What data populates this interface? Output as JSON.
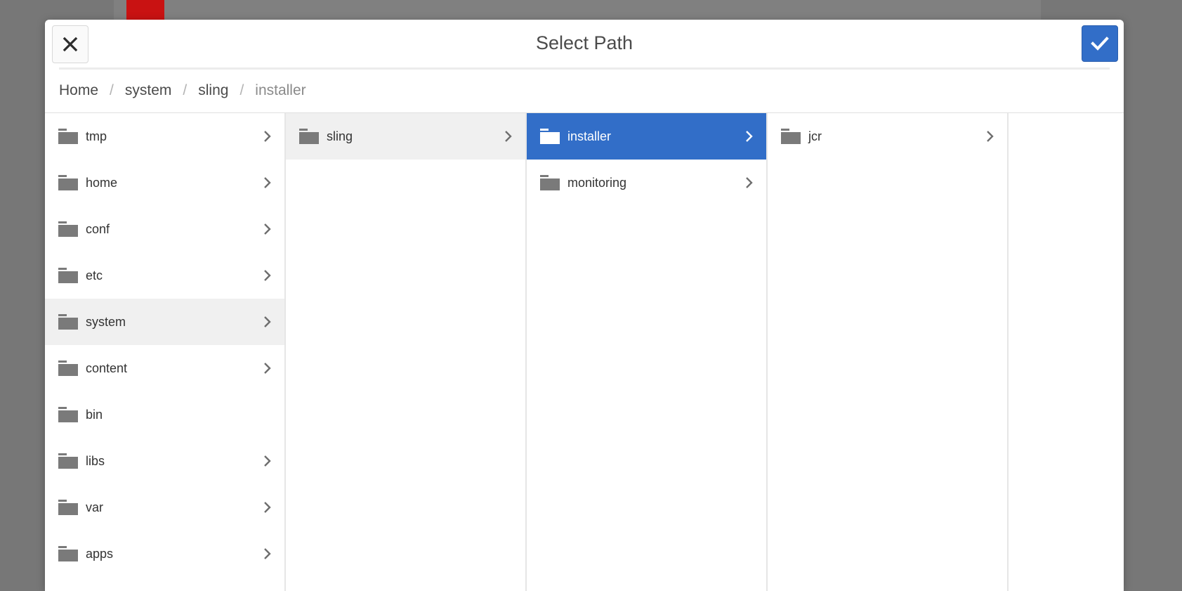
{
  "dialog": {
    "title": "Select Path",
    "close_icon": "close-icon",
    "confirm_icon": "checkmark-icon"
  },
  "breadcrumb": {
    "items": [
      "Home",
      "system",
      "sling",
      "installer"
    ],
    "separator": "/"
  },
  "columns": [
    {
      "items": [
        {
          "label": "tmp",
          "has_children": true
        },
        {
          "label": "home",
          "has_children": true
        },
        {
          "label": "conf",
          "has_children": true
        },
        {
          "label": "etc",
          "has_children": true
        },
        {
          "label": "system",
          "has_children": true,
          "state": "hover"
        },
        {
          "label": "content",
          "has_children": true
        },
        {
          "label": "bin",
          "has_children": false
        },
        {
          "label": "libs",
          "has_children": true
        },
        {
          "label": "var",
          "has_children": true
        },
        {
          "label": "apps",
          "has_children": true
        }
      ]
    },
    {
      "items": [
        {
          "label": "sling",
          "has_children": true,
          "state": "hover"
        }
      ]
    },
    {
      "items": [
        {
          "label": "installer",
          "has_children": true,
          "state": "active"
        },
        {
          "label": "monitoring",
          "has_children": true
        }
      ]
    },
    {
      "items": [
        {
          "label": "jcr",
          "has_children": true
        }
      ]
    }
  ],
  "colors": {
    "accent": "#326ec8",
    "folder": "#7a7a7a",
    "hover_row": "#f0f0f0",
    "overlay": "#777777"
  }
}
